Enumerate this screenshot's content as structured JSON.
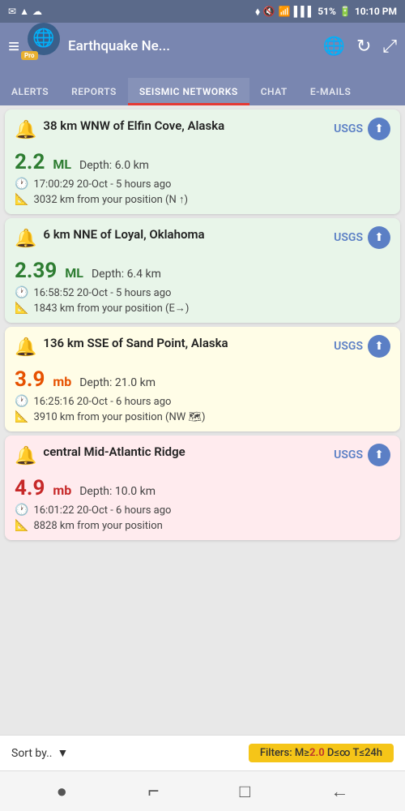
{
  "status_bar": {
    "left_icons": "✉ ⬆ ☁",
    "location": "📍",
    "wifi": "📶",
    "battery": "51%",
    "time": "10:10 PM"
  },
  "header": {
    "menu_icon": "≡",
    "app_icon": "🌐",
    "pro_badge": "Pro",
    "title": "Earthquake Ne...",
    "globe_icon": "🌐",
    "refresh_icon": "↻",
    "expand_icon": "⤢"
  },
  "tabs": [
    {
      "id": "alerts",
      "label": "ALERTS",
      "active": false
    },
    {
      "id": "reports",
      "label": "REPORTS",
      "active": false
    },
    {
      "id": "seismic",
      "label": "SEISMIC NETWORKS",
      "active": true
    },
    {
      "id": "chat",
      "label": "CHAT",
      "active": false
    },
    {
      "id": "emails",
      "label": "E-MAILS",
      "active": false
    }
  ],
  "earthquakes": [
    {
      "id": 1,
      "icon": "🔔",
      "title": "38 km WNW of Elfin Cove, Alaska",
      "source": "USGS",
      "magnitude": "2.2",
      "mag_type": "ML",
      "depth_label": "Depth:",
      "depth": "6.0 km",
      "time": "17:00:29 20-Oct - 5 hours ago",
      "distance": "3032 km from your position (N ↑)",
      "color": "green"
    },
    {
      "id": 2,
      "icon": "🔔",
      "title": "6 km NNE of Loyal, Oklahoma",
      "source": "USGS",
      "magnitude": "2.39",
      "mag_type": "ML",
      "depth_label": "Depth:",
      "depth": "6.4 km",
      "time": "16:58:52 20-Oct - 5 hours ago",
      "distance": "1843 km from your position (E→)",
      "color": "green"
    },
    {
      "id": 3,
      "icon": "🔔",
      "title": "136 km SSE of Sand Point, Alaska",
      "source": "USGS",
      "magnitude": "3.9",
      "mag_type": "mb",
      "depth_label": "Depth:",
      "depth": "21.0 km",
      "time": "16:25:16 20-Oct - 6 hours ago",
      "distance": "3910 km from your position (NW 🗺)",
      "color": "yellow"
    },
    {
      "id": 4,
      "icon": "🔔",
      "title": "central Mid-Atlantic Ridge",
      "source": "USGS",
      "magnitude": "4.9",
      "mag_type": "mb",
      "depth_label": "Depth:",
      "depth": "10.0 km",
      "time": "16:01:22 20-Oct - 6 hours ago",
      "distance": "8828 km from your position",
      "color": "red"
    }
  ],
  "sort_bar": {
    "label": "Sort by..",
    "filter_prefix": "Filters: M≥",
    "filter_mag": "2.0",
    "filter_suffix": " D≤∞ T≤24h"
  },
  "nav_bar": {
    "circle_icon": "●",
    "nav2_icon": "⌐",
    "square_icon": "□",
    "back_icon": "←"
  }
}
